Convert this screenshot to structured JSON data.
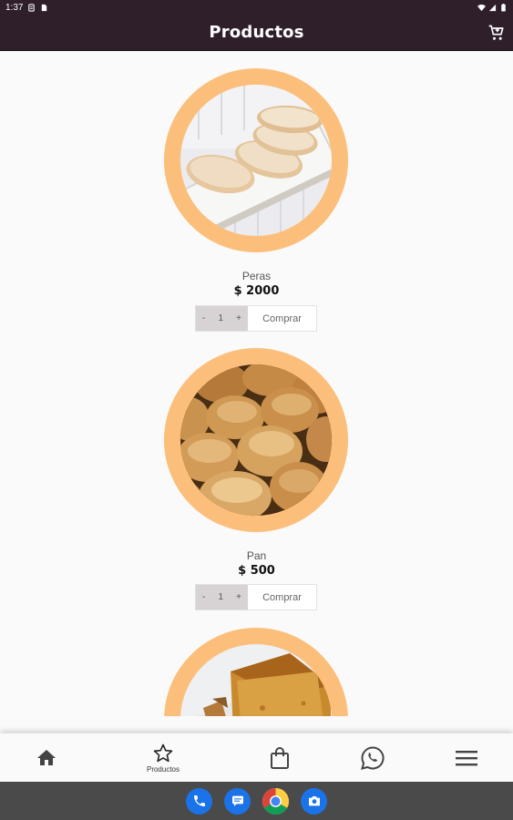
{
  "status_bar": {
    "time": "1:37"
  },
  "app_bar": {
    "title": "Productos"
  },
  "products": [
    {
      "name": "Peras",
      "price": "$ 2000",
      "quantity": "1",
      "minus": "-",
      "plus": "+",
      "buy_label": "Comprar"
    },
    {
      "name": "Pan",
      "price": "$ 500",
      "quantity": "1",
      "minus": "-",
      "plus": "+",
      "buy_label": "Comprar"
    },
    {
      "name": "",
      "price": "",
      "quantity": "",
      "buy_label": ""
    }
  ],
  "bottom_nav": {
    "items": [
      {
        "icon": "home-icon",
        "label": ""
      },
      {
        "icon": "star-icon",
        "label": "Productos",
        "active": true
      },
      {
        "icon": "shopping-bag-icon",
        "label": ""
      },
      {
        "icon": "whatsapp-icon",
        "label": ""
      },
      {
        "icon": "menu-icon",
        "label": ""
      }
    ]
  },
  "dock_apps": [
    "phone-icon",
    "messages-icon",
    "chrome-icon",
    "camera-icon"
  ],
  "colors": {
    "app_bar": "#2f1f2b",
    "ring": "#fcbf7b",
    "stepper": "#d7d3d5",
    "nav_bg": "#fafafa",
    "system_bar": "#4a4a4a"
  }
}
